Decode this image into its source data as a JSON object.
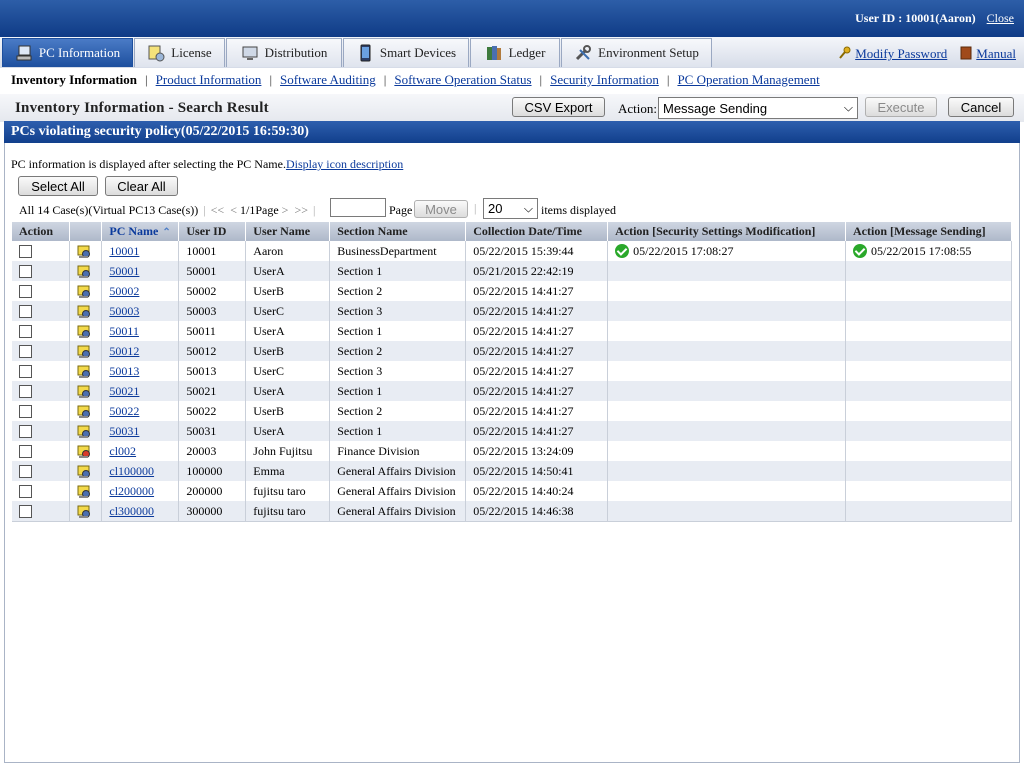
{
  "header": {
    "user_id": "User ID : 10001(Aaron)",
    "close_label": "Close"
  },
  "tabs": [
    {
      "label": "PC Information",
      "icon": "pc-info-icon"
    },
    {
      "label": "License",
      "icon": "license-icon"
    },
    {
      "label": "Distribution",
      "icon": "distribution-icon"
    },
    {
      "label": "Smart Devices",
      "icon": "smart-device-icon"
    },
    {
      "label": "Ledger",
      "icon": "ledger-icon"
    },
    {
      "label": "Environment Setup",
      "icon": "tools-icon"
    }
  ],
  "top_links": {
    "modify_password": "Modify Password",
    "manual": "Manual"
  },
  "subnav": {
    "current": "Inventory Information",
    "links": [
      "Product Information",
      "Software Auditing",
      "Software Operation Status",
      "Security Information",
      "PC Operation Management"
    ]
  },
  "page": {
    "title": "Inventory Information - Search Result",
    "csv_export": "CSV Export",
    "action_label": "Action:",
    "action_value": "Message Sending",
    "execute": "Execute",
    "cancel": "Cancel"
  },
  "section_title": "PCs violating security policy(05/22/2015 16:59:30)",
  "info": {
    "text": "PC information is displayed after selecting the PC Name.",
    "link": "Display icon description"
  },
  "buttons": {
    "select_all": "Select All",
    "clear_all": "Clear All"
  },
  "pager": {
    "count": "All 14 Case(s)(Virtual PC13 Case(s))",
    "first": "<<",
    "prev": "<",
    "page_info": "1/1Page",
    "next": ">",
    "last": ">>",
    "page_input": "",
    "page_label": "Page",
    "move": "Move",
    "per_page": "20",
    "per_page_label": "items displayed"
  },
  "table": {
    "columns": [
      "Action",
      "",
      "PC Name",
      "User ID",
      "User Name",
      "Section Name",
      "Collection Date/Time",
      "Action [Security Settings Modification]",
      "Action [Message Sending]"
    ],
    "rows": [
      {
        "pc": "10001",
        "uid": "10001",
        "user": "Aaron",
        "section": "BusinessDepartment",
        "date": "05/22/2015 15:39:44",
        "sec_mod": "05/22/2015 17:08:27",
        "msg": "05/22/2015 17:08:55",
        "icon": "pc-user-icon"
      },
      {
        "pc": "50001",
        "uid": "50001",
        "user": "UserA",
        "section": "Section 1",
        "date": "05/21/2015 22:42:19",
        "sec_mod": "",
        "msg": "",
        "icon": "pc-user-icon"
      },
      {
        "pc": "50002",
        "uid": "50002",
        "user": "UserB",
        "section": "Section 2",
        "date": "05/22/2015 14:41:27",
        "sec_mod": "",
        "msg": "",
        "icon": "pc-user-icon"
      },
      {
        "pc": "50003",
        "uid": "50003",
        "user": "UserC",
        "section": "Section 3",
        "date": "05/22/2015 14:41:27",
        "sec_mod": "",
        "msg": "",
        "icon": "pc-user-icon"
      },
      {
        "pc": "50011",
        "uid": "50011",
        "user": "UserA",
        "section": "Section 1",
        "date": "05/22/2015 14:41:27",
        "sec_mod": "",
        "msg": "",
        "icon": "pc-user-icon"
      },
      {
        "pc": "50012",
        "uid": "50012",
        "user": "UserB",
        "section": "Section 2",
        "date": "05/22/2015 14:41:27",
        "sec_mod": "",
        "msg": "",
        "icon": "pc-user-icon"
      },
      {
        "pc": "50013",
        "uid": "50013",
        "user": "UserC",
        "section": "Section 3",
        "date": "05/22/2015 14:41:27",
        "sec_mod": "",
        "msg": "",
        "icon": "pc-user-icon"
      },
      {
        "pc": "50021",
        "uid": "50021",
        "user": "UserA",
        "section": "Section 1",
        "date": "05/22/2015 14:41:27",
        "sec_mod": "",
        "msg": "",
        "icon": "pc-user-icon"
      },
      {
        "pc": "50022",
        "uid": "50022",
        "user": "UserB",
        "section": "Section 2",
        "date": "05/22/2015 14:41:27",
        "sec_mod": "",
        "msg": "",
        "icon": "pc-user-icon"
      },
      {
        "pc": "50031",
        "uid": "50031",
        "user": "UserA",
        "section": "Section 1",
        "date": "05/22/2015 14:41:27",
        "sec_mod": "",
        "msg": "",
        "icon": "pc-user-icon"
      },
      {
        "pc": "cl002",
        "uid": "20003",
        "user": "John Fujitsu",
        "section": "Finance Division",
        "date": "05/22/2015 13:24:09",
        "sec_mod": "",
        "msg": "",
        "icon": "pc-warning-icon"
      },
      {
        "pc": "cl100000",
        "uid": "100000",
        "user": "Emma",
        "section": "General Affairs Division",
        "date": "05/22/2015 14:50:41",
        "sec_mod": "",
        "msg": "",
        "icon": "pc-user-icon"
      },
      {
        "pc": "cl200000",
        "uid": "200000",
        "user": "fujitsu taro",
        "section": "General Affairs Division",
        "date": "05/22/2015 14:40:24",
        "sec_mod": "",
        "msg": "",
        "icon": "pc-user-icon"
      },
      {
        "pc": "cl300000",
        "uid": "300000",
        "user": "fujitsu taro",
        "section": "General Affairs Division",
        "date": "05/22/2015 14:46:38",
        "sec_mod": "",
        "msg": "",
        "icon": "pc-user-icon"
      }
    ]
  },
  "colors": {
    "header_blue": "#113f8c",
    "link": "#0b3a9c",
    "row_alt": "#e8ecf3",
    "ok_green": "#2aa82a"
  }
}
